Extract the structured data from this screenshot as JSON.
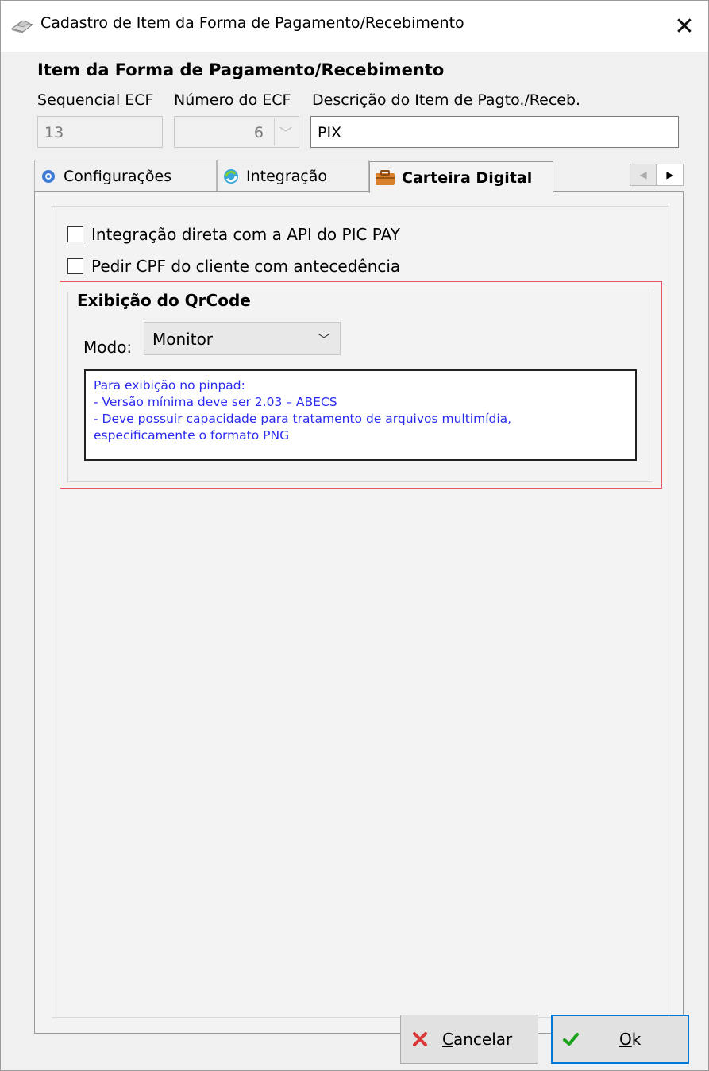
{
  "window": {
    "title": "Cadastro de Item da Forma de Pagamento/Recebimento",
    "close_glyph": "✕"
  },
  "group": {
    "title": "Item da Forma de Pagamento/Recebimento"
  },
  "fields": {
    "sequencial": {
      "label_u": "S",
      "label_rest": "equencial ECF",
      "value": "13"
    },
    "numero": {
      "label_pre": "Número do EC",
      "label_u": "F",
      "value": "6"
    },
    "descricao": {
      "label": "Descrição do Item de Pagto./Receb.",
      "value": "PIX"
    }
  },
  "tabs": [
    {
      "label": "Configurações",
      "icon": "gear-icon",
      "active": false
    },
    {
      "label": "Integração",
      "icon": "sync-icon",
      "active": false
    },
    {
      "label": "Carteira Digital",
      "icon": "wallet-icon",
      "active": true
    }
  ],
  "tab_scroll": {
    "left": "◀",
    "right": "▶"
  },
  "carteira": {
    "checkbox_api": {
      "label": "Integração direta com a API do PIC PAY",
      "checked": false
    },
    "checkbox_cpf": {
      "label": "Pedir CPF do cliente com antecedência",
      "checked": false
    },
    "qrcode": {
      "title": "Exibição do QrCode",
      "modo_label": "Modo:",
      "modo_value": "Monitor",
      "note_lines": [
        "Para exibição no pinpad:",
        "- Versão mínima deve ser 2.03 – ABECS",
        "- Deve possuir capacidade para tratamento de arquivos multimídia,",
        "especificamente o formato PNG"
      ]
    }
  },
  "buttons": {
    "cancel": {
      "u": "C",
      "rest": "ancelar",
      "icon": "close-icon",
      "icon_color": "#d83a3a"
    },
    "ok": {
      "u": "O",
      "rest": "k",
      "icon": "checkmark-icon",
      "icon_color": "#1aa21a"
    }
  }
}
